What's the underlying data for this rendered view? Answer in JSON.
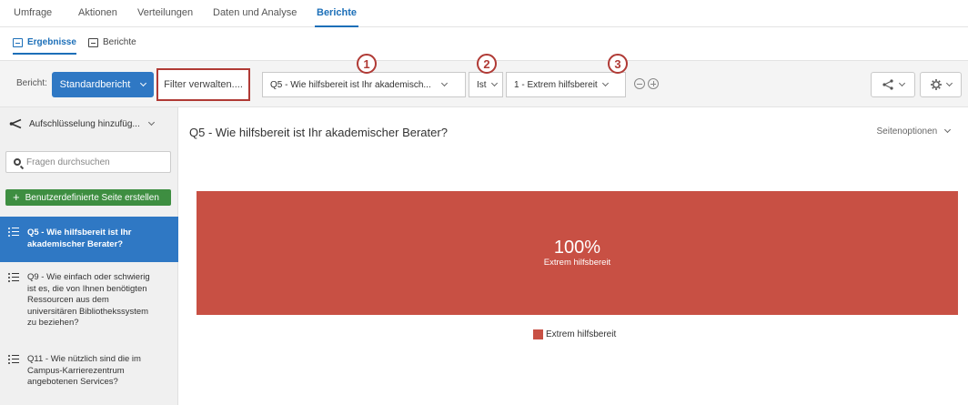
{
  "topnav": {
    "tabs": [
      "Umfrage",
      "Aktionen",
      "Verteilungen",
      "Daten und Analyse",
      "Berichte"
    ],
    "active": "Berichte"
  },
  "subnav": {
    "tabs": [
      "Ergebnisse",
      "Berichte"
    ],
    "active": "Ergebnisse"
  },
  "toolbar": {
    "report_label": "Bericht:",
    "report_value": "Standardbericht",
    "filter_button": "Filter verwalten....",
    "question_dropdown": "Q5 - Wie hilfsbereit ist Ihr akademisch...",
    "operator_dropdown": "Ist",
    "answer_dropdown": "1 - Extrem hilfsbereit",
    "markers": [
      "1",
      "2",
      "3"
    ]
  },
  "sidebar": {
    "breakdown": "Aufschlüsselung hinzufüg...",
    "search_placeholder": "Fragen durchsuchen",
    "create_page": "Benutzerdefinierte Seite erstellen",
    "questions": [
      {
        "lines": [
          "Q5 - Wie hilfsbereit ist Ihr",
          "akademischer Berater?"
        ],
        "active": true
      },
      {
        "lines": [
          "Q9 - Wie einfach oder schwierig",
          "ist es, die von Ihnen benötigten",
          "Ressourcen aus dem",
          "universitären Bibliothekssystem",
          "zu beziehen?"
        ],
        "active": false
      },
      {
        "lines": [
          "Q11 - Wie nützlich sind die im",
          "Campus-Karrierezentrum",
          "angebotenen Services?"
        ],
        "active": false
      }
    ]
  },
  "main": {
    "question_title": "Q5 - Wie hilfsbereit ist Ihr akademischer Berater?",
    "page_options": "Seitenoptionen"
  },
  "chart_data": {
    "type": "bar",
    "categories": [
      "Extrem hilfsbereit"
    ],
    "values": [
      100
    ],
    "value_label": "100%",
    "legend": [
      "Extrem hilfsbereit"
    ],
    "color": "#c85044"
  },
  "colors": {
    "accent": "#2f78c4",
    "bar": "#c85044",
    "highlight": "#b03a35",
    "create_button": "#3e8e41"
  }
}
